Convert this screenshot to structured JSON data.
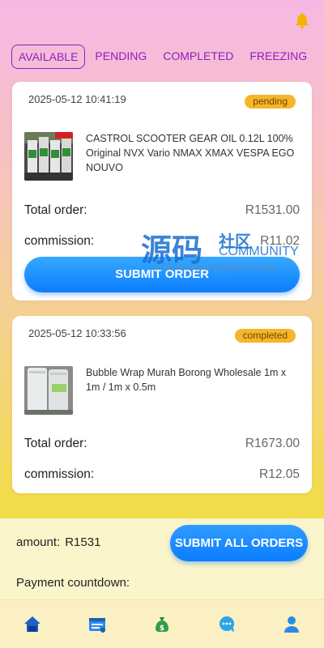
{
  "tabs": [
    {
      "label": "AVAILABLE",
      "active": true
    },
    {
      "label": "PENDING",
      "active": false
    },
    {
      "label": "COMPLETED",
      "active": false
    },
    {
      "label": "FREEZING",
      "active": false
    }
  ],
  "orders": [
    {
      "time": "2025-05-12 10:41:19",
      "status": "pending",
      "product_name": "CASTROL SCOOTER GEAR OIL 0.12L 100% Original NVX Vario NMAX XMAX VESPA EGO NOUVO",
      "total_label": "Total order:",
      "total_value": "R1531.00",
      "commission_label": "commission:",
      "commission_value": "R11.02",
      "submit_label": "SUBMIT ORDER"
    },
    {
      "time": "2025-05-12 10:33:56",
      "status": "completed",
      "product_name": "Bubble Wrap Murah Borong Wholesale 1m x 1m / 1m x 0.5m",
      "total_label": "Total order:",
      "total_value": "R1673.00",
      "commission_label": "commission:",
      "commission_value": "R12.05"
    }
  ],
  "footer": {
    "amount_label": "amount:",
    "amount_value": "R1531",
    "submit_all_label": "SUBMIT ALL ORDERS",
    "countdown_label": "Payment countdown:"
  },
  "watermark": {
    "title": "源码",
    "sub1": "社区",
    "sub2": "COMMUNITY",
    "url": "www.shequym.com"
  },
  "nav": [
    {
      "icon": "home-icon"
    },
    {
      "icon": "orders-icon"
    },
    {
      "icon": "money-bag-icon"
    },
    {
      "icon": "chat-icon"
    },
    {
      "icon": "user-icon"
    }
  ],
  "colors": {
    "accent_purple": "#8a1fc2",
    "button_blue": "#0b7dff",
    "badge_orange": "#f7b52a"
  }
}
